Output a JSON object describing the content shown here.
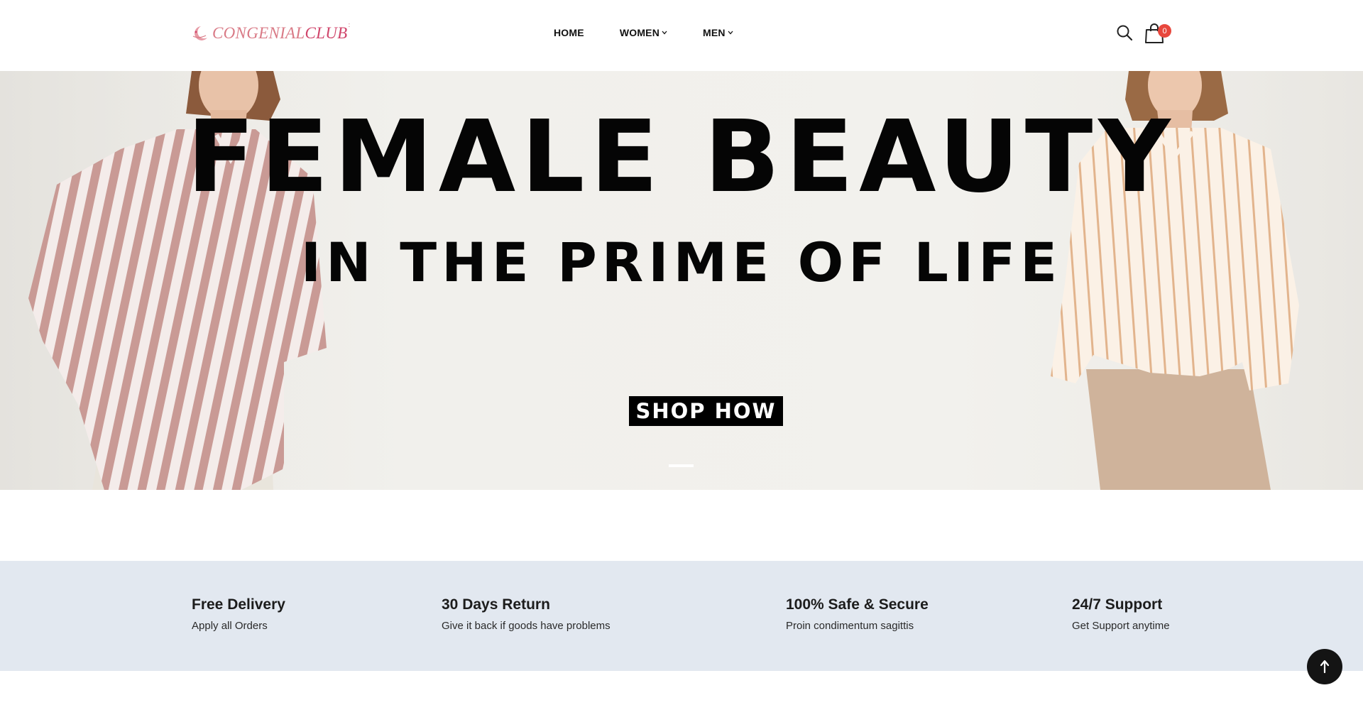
{
  "header": {
    "logo": {
      "text_pre": "CONGENIAL",
      "text_post": "CLUB",
      "dots": ":"
    },
    "nav": [
      {
        "label": "HOME",
        "has_dropdown": false
      },
      {
        "label": "WOMEN",
        "has_dropdown": true
      },
      {
        "label": "MEN",
        "has_dropdown": true
      }
    ],
    "search_icon": "search-icon",
    "cart_icon": "shopping-bag-icon",
    "cart_count": "0"
  },
  "hero": {
    "headline": "FEMALE BEAUTY",
    "subline": "IN THE PRIME OF LIFE",
    "cta_label": "SHOP HOW",
    "slide_count": 1,
    "active_slide": 1
  },
  "features": [
    {
      "title": "Free Delivery",
      "subtitle": "Apply all Orders"
    },
    {
      "title": "30 Days Return",
      "subtitle": "Give it back if goods have problems"
    },
    {
      "title": "100% Safe & Secure",
      "subtitle": "Proin condimentum sagittis"
    },
    {
      "title": "24/7 Support",
      "subtitle": "Get Support anytime"
    }
  ],
  "back_to_top_icon": "arrow-up-icon",
  "colors": {
    "brand": "#d0456b",
    "badge": "#e8473d",
    "features_bg": "#e2e8f0",
    "cta_bg": "#000000"
  }
}
